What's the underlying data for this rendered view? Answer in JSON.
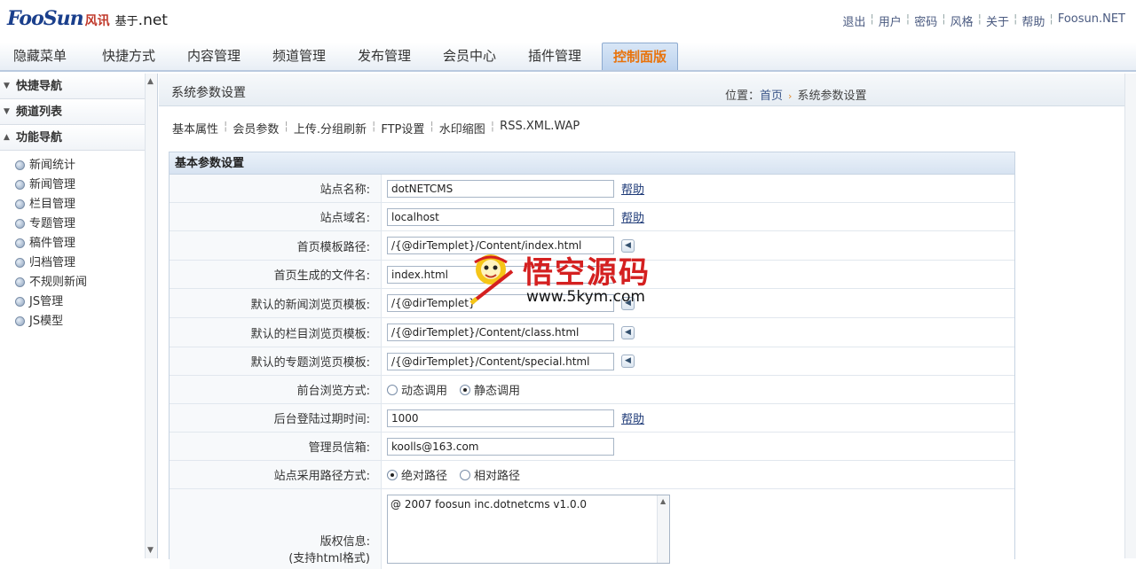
{
  "header": {
    "logo_mark": "FooSun",
    "logo_cn": "风讯",
    "logo_sub": "基于",
    "logo_net": ".net",
    "links": [
      "退出",
      "用户",
      "密码",
      "风格",
      "关于",
      "帮助",
      "Foosun.NET"
    ]
  },
  "nav": {
    "items": [
      "隐藏菜单",
      "快捷方式",
      "内容管理",
      "频道管理",
      "发布管理",
      "会员中心",
      "插件管理",
      "控制面版"
    ]
  },
  "sidebar": {
    "sections": [
      "快捷导航",
      "频道列表",
      "功能导航"
    ],
    "items": [
      "新闻统计",
      "新闻管理",
      "栏目管理",
      "专题管理",
      "稿件管理",
      "归档管理",
      "不规则新闻",
      "JS管理",
      "JS模型"
    ]
  },
  "main": {
    "title": "系统参数设置",
    "crumb_label": "位置：",
    "crumb_home": "首页",
    "crumb_current": "系统参数设置",
    "tabs": [
      "基本属性",
      "会员参数",
      "上传.分组刷新",
      "FTP设置",
      "水印缩图",
      "RSS.XML.WAP"
    ]
  },
  "form": {
    "heading": "基本参数设置",
    "help": "帮助",
    "site_name_label": "站点名称:",
    "site_name": "dotNETCMS",
    "domain_label": "站点域名:",
    "domain": "localhost",
    "index_tpl_label": "首页模板路径:",
    "index_tpl": "/{@dirTemplet}/Content/index.html",
    "index_file_label": "首页生成的文件名:",
    "index_file": "index.html",
    "news_tpl_label": "默认的新闻浏览页模板:",
    "news_tpl": "/{@dirTemplet}",
    "class_tpl_label": "默认的栏目浏览页模板:",
    "class_tpl": "/{@dirTemplet}/Content/class.html",
    "special_tpl_label": "默认的专题浏览页模板:",
    "special_tpl": "/{@dirTemplet}/Content/special.html",
    "browse_label": "前台浏览方式:",
    "browse_opt1": "动态调用",
    "browse_opt2": "静态调用",
    "timeout_label": "后台登陆过期时间:",
    "timeout": "1000",
    "email_label": "管理员信箱:",
    "email": "koolls@163.com",
    "path_label": "站点采用路径方式:",
    "path_opt1": "绝对路径",
    "path_opt2": "相对路径",
    "copyright_label": "版权信息:",
    "copyright_note": "(支持html格式)",
    "copyright": "@ 2007 foosun inc.dotnetcms v1.0.0"
  },
  "watermark": {
    "text": "悟空源码",
    "url": "www.5kym.com"
  }
}
